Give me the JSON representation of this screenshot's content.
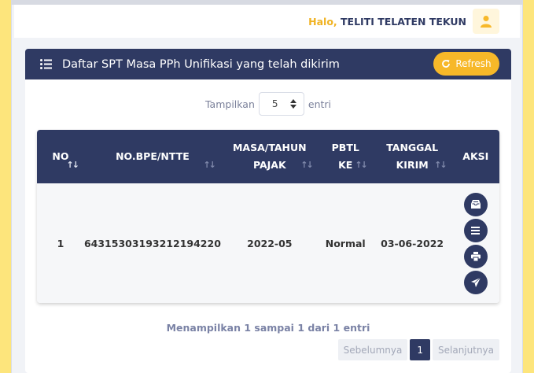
{
  "header": {
    "greeting": "Halo,",
    "username": "TELITI TELATEN TEKUN",
    "avatar_icon": "user-icon"
  },
  "card": {
    "title": "Daftar SPT Masa PPh Unifikasi yang telah dikirim",
    "refresh_label": "Refresh",
    "length_prefix": "Tampilkan",
    "length_value": "5",
    "length_suffix": "entri"
  },
  "table": {
    "columns": [
      {
        "line1": "NO",
        "line2": ""
      },
      {
        "line1": "NO.BPE/NTTE",
        "line2": ""
      },
      {
        "line1": "MASA/TAHUN",
        "line2": "PAJAK"
      },
      {
        "line1": "PBTL",
        "line2": "KE"
      },
      {
        "line1": "TANGGAL",
        "line2": "KIRIM"
      },
      {
        "line1": "AKSI",
        "line2": ""
      }
    ],
    "rows": [
      {
        "no": "1",
        "nobpe": "64315303193212194220",
        "masa": "2022-05",
        "pbtl": "Normal",
        "tanggal": "03-06-2022"
      }
    ]
  },
  "info": "Menampilkan 1 sampai 1 dari 1 entri",
  "pager": {
    "prev": "Sebelumnya",
    "current": "1",
    "next": "Selanjutnya"
  },
  "colors": {
    "primary": "#2f3a63",
    "accent": "#f7b829",
    "background": "#fdeb8c"
  }
}
